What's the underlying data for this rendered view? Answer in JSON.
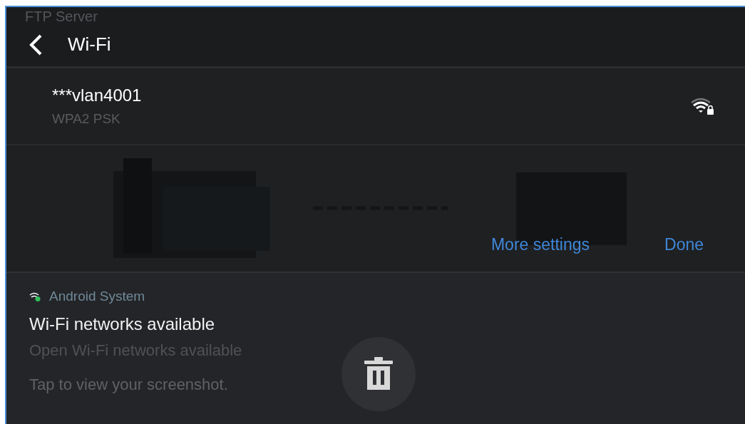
{
  "background": {
    "title": "FTP Server"
  },
  "header": {
    "title": "Wi-Fi"
  },
  "network": {
    "name": "***vlan4001",
    "security": "WPA2 PSK",
    "locked": true
  },
  "actions": [
    {
      "label": "More settings"
    },
    {
      "label": "Done"
    }
  ],
  "notification": {
    "app": "Android System",
    "title": "Wi-Fi networks available",
    "text": "Open Wi-Fi networks available",
    "hint": "Tap to view your screenshot."
  }
}
